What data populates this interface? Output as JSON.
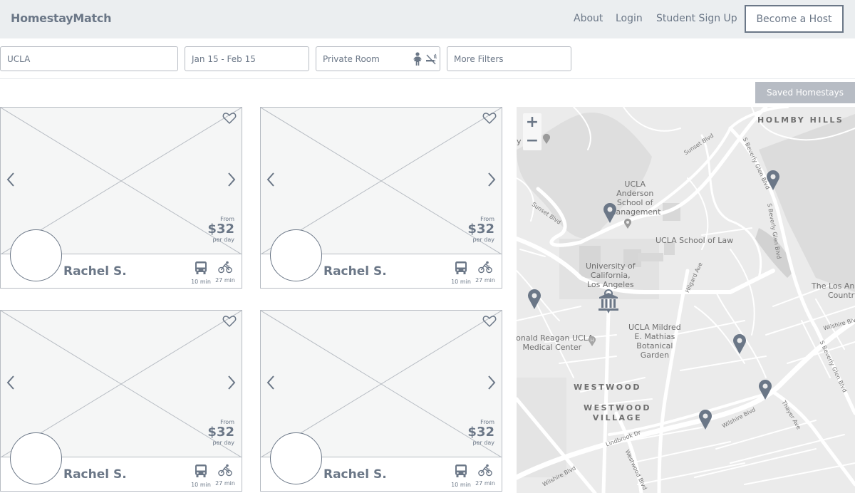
{
  "header": {
    "logo": "HomestayMatch",
    "nav": {
      "about": "About",
      "login": "Login",
      "signup": "Student Sign Up",
      "host": "Become a Host"
    }
  },
  "search": {
    "location": "UCLA",
    "dates": "Jan 15 - Feb 15",
    "room_type": "Private Room",
    "room_icons": [
      "female-icon",
      "no-smoking-icon"
    ],
    "more_filters": "More Filters"
  },
  "saved_label": "Saved Homestays",
  "listings": [
    {
      "host": "Rachel S.",
      "price_from": "From",
      "price": "$32",
      "price_unit": "per day",
      "bus_time": "10 min",
      "bike_time": "27 min"
    },
    {
      "host": "Rachel S.",
      "price_from": "From",
      "price": "$32",
      "price_unit": "per day",
      "bus_time": "10 min",
      "bike_time": "27 min"
    },
    {
      "host": "Rachel S.",
      "price_from": "From",
      "price": "$32",
      "price_unit": "per day",
      "bus_time": "10 min",
      "bike_time": "27 min"
    },
    {
      "host": "Rachel S.",
      "price_from": "From",
      "price": "$32",
      "price_unit": "per day",
      "bus_time": "10 min",
      "bike_time": "27 min"
    }
  ],
  "map": {
    "zoom_in": "+",
    "zoom_out": "−",
    "labels": {
      "holmby": "HOLMBY HILLS",
      "anderson": "UCLA\nAnderson\nSchool of\nManagement",
      "law": "UCLA School of Law",
      "ucla": "University of\nCalifornia,\nLos Angeles",
      "garden": "UCLA Mildred\nE. Mathias\nBotanical\nGarden",
      "medical": "Ronald Reagan UCLA\nMedical Center",
      "westwood": "WESTWOOD",
      "village": "WESTWOOD\nVILLAGE",
      "country": "The Los Angeles\nCountry",
      "partial_y": "y"
    },
    "streets": {
      "sunset1": "Sunset Blvd",
      "sunset2": "Sunset Blvd",
      "beverly1": "S Beverly Glen Blvd",
      "beverly2": "S Beverly Glen Blvd",
      "beverly3": "S Beverly Glen Blvd",
      "hilgard": "Hilgard Ave",
      "wilshire1": "Wilshire Blvd",
      "wilshire2": "Wilshire Blvd",
      "wilshire3": "Wilshire Blvd",
      "lindbrook": "Lindbrook Dr",
      "westwood_blvd": "Westwood Blvd",
      "thayer": "Thayer Ave"
    },
    "pin_color": "#6b7787"
  }
}
